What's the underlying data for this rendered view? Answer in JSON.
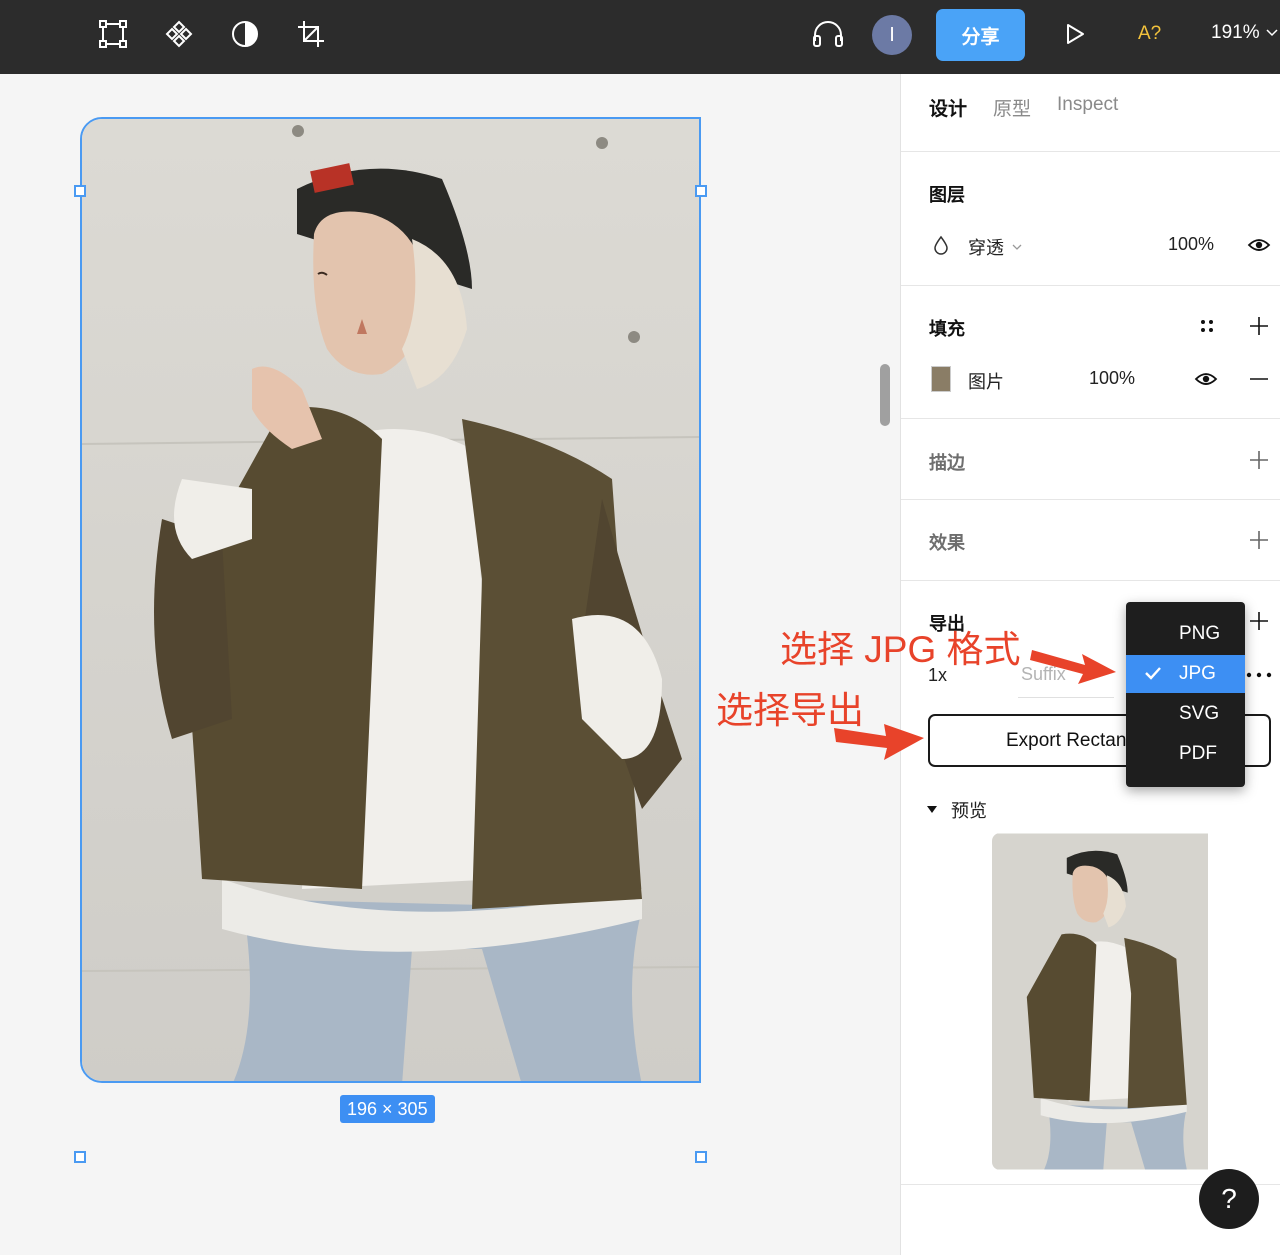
{
  "toolbar": {
    "tools": [
      "frame-tool-icon",
      "component-icon",
      "contrast-icon",
      "crop-icon"
    ],
    "audio_icon": "headphones-icon",
    "avatar_initial": "I",
    "share_label": "分享",
    "play_icon": "play-icon",
    "font_check": "A?",
    "zoom": "191%"
  },
  "canvas": {
    "size_label": "196 × 305",
    "selection_color": "#4a9af2"
  },
  "annotations": {
    "select_jpg": "选择 JPG 格式",
    "select_export": "选择导出",
    "color": "#e8432a"
  },
  "panel": {
    "tabs": [
      {
        "label": "设计",
        "active": true
      },
      {
        "label": "原型",
        "active": false
      },
      {
        "label": "Inspect",
        "active": false
      }
    ],
    "layer": {
      "title": "图层",
      "blend_mode": "穿透",
      "opacity": "100%"
    },
    "fill": {
      "title": "填充",
      "type": "图片",
      "opacity": "100%"
    },
    "stroke": {
      "title": "描边"
    },
    "effects": {
      "title": "效果"
    },
    "export": {
      "title": "导出",
      "scale": "1x",
      "suffix_placeholder": "Suffix",
      "button_label": "Export Rectangle 1",
      "formats": [
        "PNG",
        "JPG",
        "SVG",
        "PDF"
      ],
      "selected_format": "JPG"
    },
    "preview": {
      "title": "预览"
    }
  },
  "help_label": "?"
}
